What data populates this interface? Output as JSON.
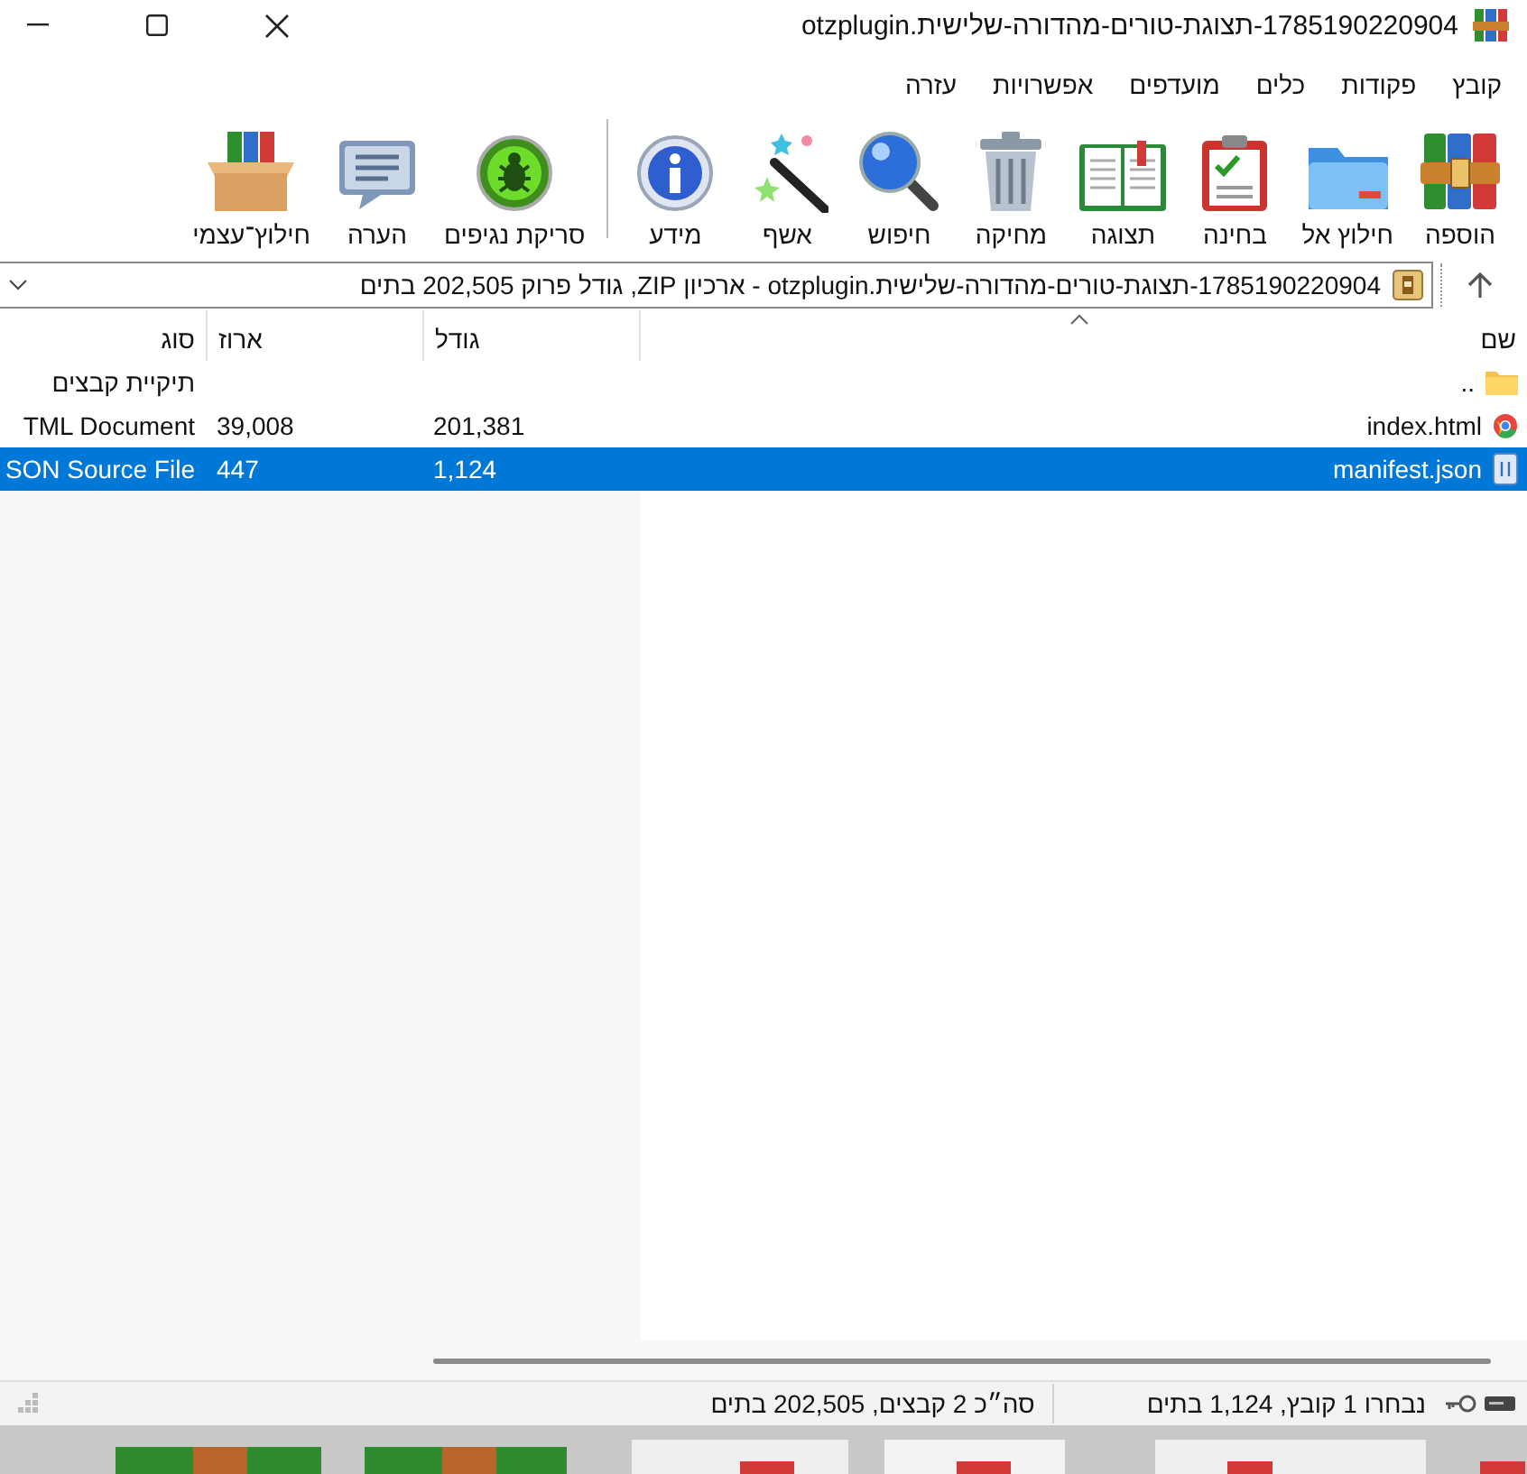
{
  "window": {
    "title": "1785190220904-תצוגת-טורים-מהדורה-שלישית.otzplugin"
  },
  "menu": [
    "קובץ",
    "פקודות",
    "כלים",
    "מועדפים",
    "אפשרויות",
    "עזרה"
  ],
  "toolbar_groups": [
    {
      "buttons": [
        {
          "label": "הוספה",
          "kind": "add"
        },
        {
          "label": "חילוץ אל",
          "kind": "extract"
        },
        {
          "label": "בחינה",
          "kind": "test"
        },
        {
          "label": "תצוגה",
          "kind": "view"
        },
        {
          "label": "מחיקה",
          "kind": "delete"
        },
        {
          "label": "חיפוש",
          "kind": "find"
        },
        {
          "label": "אשף",
          "kind": "wizard"
        },
        {
          "label": "מידע",
          "kind": "info"
        }
      ]
    },
    {
      "buttons": [
        {
          "label": "סריקת נגיפים",
          "kind": "virus"
        },
        {
          "label": "הערה",
          "kind": "comment"
        },
        {
          "label": "חילוץ־עצמי",
          "kind": "sfx"
        }
      ]
    }
  ],
  "address": {
    "text": "1785190220904-תצוגת-טורים-מהדורה-שלישית.otzplugin - ארכיון ZIP, גודל פרוק 202,505 בתים"
  },
  "table": {
    "columns": [
      "שם",
      "גודל",
      "ארוז",
      "סוג"
    ],
    "rows": [
      {
        "kind": "folder",
        "name": "..",
        "size": "",
        "packed": "",
        "type": "תיקיית קבצים",
        "selected": false
      },
      {
        "kind": "html",
        "name": "index.html",
        "size": "201,381",
        "packed": "39,008",
        "type": "TML Document",
        "selected": false
      },
      {
        "kind": "json",
        "name": "manifest.json",
        "size": "1,124",
        "packed": "447",
        "type": "SON Source File",
        "selected": true
      }
    ]
  },
  "status_bar": {
    "selection": "נבחרו 1 קובץ, 1,124 בתים",
    "total": "סה״כ 2 קבצים, 202,505 בתים"
  }
}
